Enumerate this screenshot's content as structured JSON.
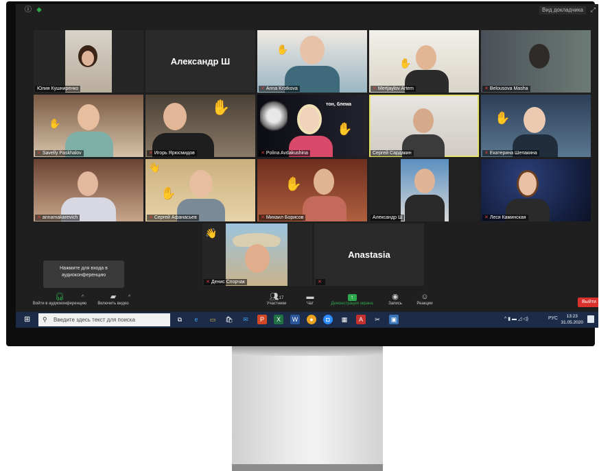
{
  "topbar": {
    "speaker_view_label": "Вид докладчика"
  },
  "participants": [
    {
      "name": "Юлия Кушниренко",
      "muted": false
    },
    {
      "name": "Александр Ш",
      "muted": false
    },
    {
      "name": "Anna Krotkova",
      "muted": true
    },
    {
      "name": "Mertjaylov Artem",
      "muted": true
    },
    {
      "name": "Belousova Masha",
      "muted": true
    },
    {
      "name": "Savelly Paskhalov",
      "muted": true
    },
    {
      "name": "Игорь Ярюсмидов",
      "muted": true
    },
    {
      "name": "Polina Avdakushina",
      "muted": true
    },
    {
      "name": "Сергей Сардакин",
      "muted": false
    },
    {
      "name": "Екатерина Шепакина",
      "muted": true
    },
    {
      "name": "annamakarevich",
      "muted": true
    },
    {
      "name": "Сергей Афанасьев",
      "muted": true
    },
    {
      "name": "Михаил Борисов",
      "muted": true
    },
    {
      "name": "Александр Ш",
      "muted": false
    },
    {
      "name": "Леся Каминская",
      "muted": true
    },
    {
      "name": "Денис Спорчак",
      "muted": true
    },
    {
      "name": "Anastasia",
      "muted": true
    }
  ],
  "tile_texts": {
    "big_name_1": "Александр Ш",
    "big_name_2": "Anastasia",
    "background_caption": "тон, блема"
  },
  "tooltip": "Нажмите для входа в аудиоконференцию",
  "controls": {
    "join_audio": "Войти в аудиоконференцию",
    "start_video": "Включить видео",
    "participants": "Участники",
    "participants_count": "17",
    "chat": "Чат",
    "share_screen": "Демонстрация экрана",
    "record": "Запись",
    "reactions": "Реакции",
    "leave": "Выйти"
  },
  "taskbar": {
    "search_placeholder": "Введите здесь текст для поиска",
    "lang": "РУС",
    "time": "13:23",
    "date": "31.05.2020"
  },
  "colors": {
    "accent": "#2ea84d",
    "leave": "#d9302b",
    "taskbar": "#1c2c48",
    "active_speaker": "#e3e36a"
  }
}
